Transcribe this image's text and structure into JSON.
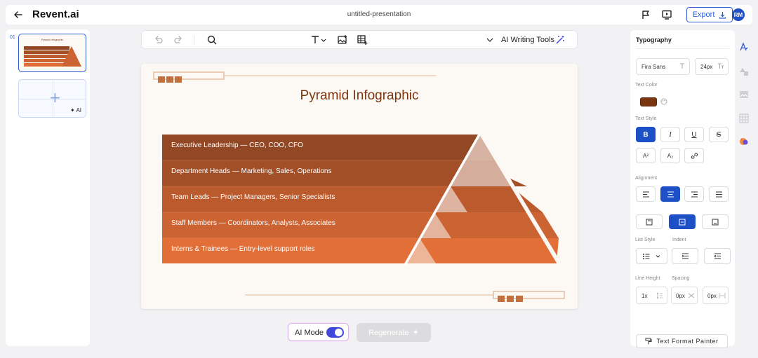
{
  "app": {
    "brand": "Revent.ai",
    "doc_title": "untitled-presentation",
    "export_label": "Export",
    "avatar_initials": "RM"
  },
  "slides_panel": {
    "slide_number": "01",
    "thumb_title": "Pyramid Infographic",
    "add_ai_label": "AI"
  },
  "toolbar": {
    "ai_tools_label": "AI Writing Tools"
  },
  "slide": {
    "title": "Pyramid Infographic",
    "tiers": [
      "Executive Leadership — CEO, COO, CFO",
      "Department Heads — Marketing, Sales, Operations",
      "Team Leads — Project Managers, Senior Specialists",
      "Staff Members — Coordinators, Analysts, Associates",
      "Interns & Trainees — Entry-level support roles"
    ],
    "colors": [
      "#924824",
      "#a24e26",
      "#bb5a2c",
      "#cc6333",
      "#e16f37"
    ],
    "accent": "#c2703f"
  },
  "bottom": {
    "ai_mode_label": "AI Mode",
    "regenerate_label": "Regenerate"
  },
  "panel": {
    "heading": "Typography",
    "font_family": "Fira Sans",
    "font_size": "24px",
    "text_color_label": "Text Color",
    "text_color": "#7a3410",
    "text_style_label": "Text Style",
    "alignment_label": "Alignment",
    "list_style_label": "List Style",
    "indent_label": "Indent",
    "line_height_label": "Line Height",
    "spacing_label": "Spacing",
    "line_height_value": "1x",
    "spacing_value_1": "0px",
    "spacing_value_2": "0px",
    "superscript": "A²",
    "subscript": "A₂",
    "painter_label": "Text Format Painter"
  }
}
